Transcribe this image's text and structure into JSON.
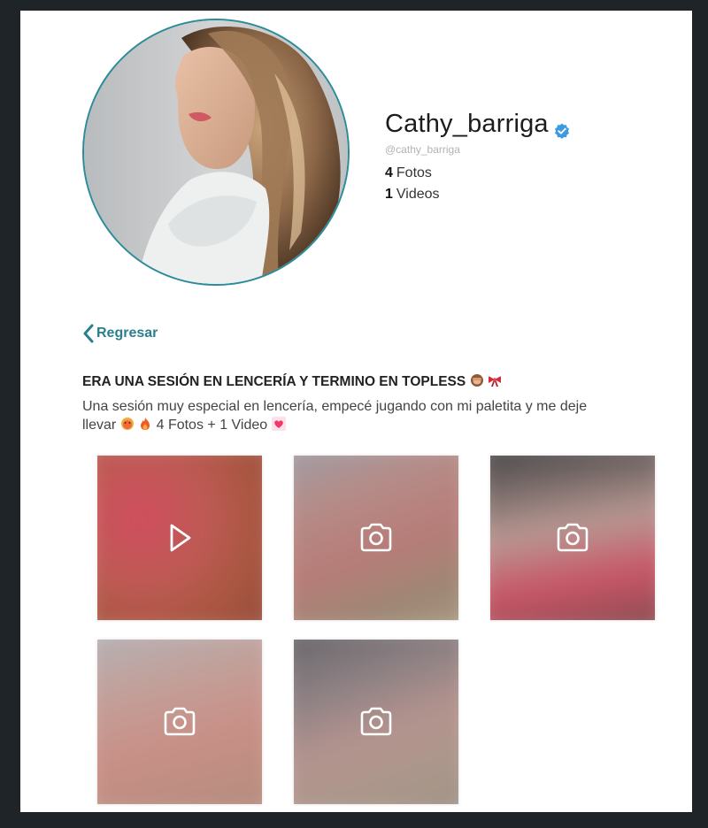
{
  "profile": {
    "name": "Cathy_barriga",
    "handle": "@cathy_barriga",
    "photos_count": "4",
    "photos_label": "Fotos",
    "videos_count": "1",
    "videos_label": "Videos",
    "verified": true,
    "verified_color": "#3b9ae1"
  },
  "navigation": {
    "back_label": "Regresar",
    "accent_color": "#2a7f8f"
  },
  "post": {
    "title": "ERA UNA SESIÓN EN LENCERÍA Y TERMINO EN TOPLESS",
    "title_emojis": [
      "see-no-evil-monkey-emoji",
      "ribbon-emoji"
    ],
    "description_line1": "Una sesión muy especial en lencería, empecé jugando con mi paletita y me deje",
    "description_line2_prefix": "llevar",
    "description_emojis": [
      "hot-face-emoji",
      "fire-emoji",
      "heart-emoji"
    ],
    "description_line2_suffix": "4 Fotos + 1 Video"
  },
  "media": [
    {
      "type": "video",
      "icon": "play-icon",
      "locked": true
    },
    {
      "type": "photo",
      "icon": "camera-icon",
      "locked": true
    },
    {
      "type": "photo",
      "icon": "camera-icon",
      "locked": true
    },
    {
      "type": "photo",
      "icon": "camera-icon",
      "locked": true
    },
    {
      "type": "photo",
      "icon": "camera-icon",
      "locked": true
    }
  ]
}
